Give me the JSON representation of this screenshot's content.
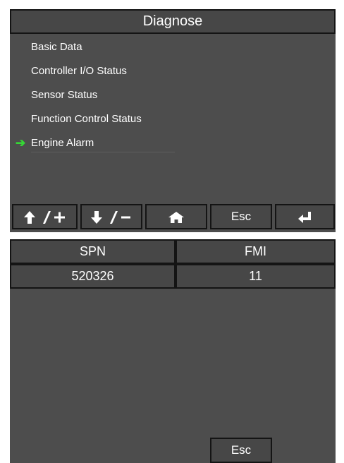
{
  "screen1": {
    "title": "Diagnose",
    "menu": [
      {
        "label": "Basic Data"
      },
      {
        "label": "Controller I/O Status"
      },
      {
        "label": "Sensor Status"
      },
      {
        "label": "Function Control Status"
      },
      {
        "label": "Engine Alarm",
        "selected": true
      }
    ],
    "selected_arrow": "➔",
    "buttons": {
      "up_plus": "↑/+",
      "down_minus": "↓/-",
      "esc": "Esc"
    },
    "icons": {
      "up": "arrow-up-icon",
      "down": "arrow-down-icon",
      "home": "home-icon",
      "enter": "enter-icon"
    }
  },
  "screen2": {
    "columns": [
      "SPN",
      "FMI"
    ],
    "rows": [
      [
        "520326",
        "11"
      ]
    ],
    "esc": "Esc"
  },
  "colors": {
    "panel": "#4d4d4d",
    "cell": "#474747",
    "border": "#141414",
    "text": "#ffffff",
    "selected_arrow": "#35d635"
  }
}
